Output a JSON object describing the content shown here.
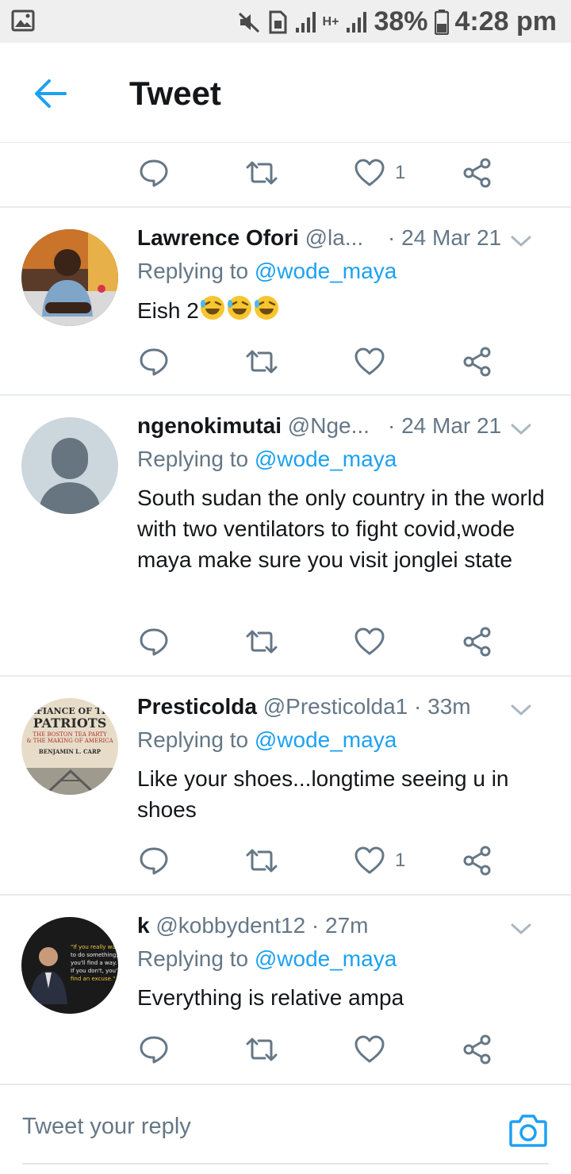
{
  "status_bar": {
    "battery": "38%",
    "time": "4:28 pm",
    "network": "H+"
  },
  "header": {
    "title": "Tweet"
  },
  "top_actions": {
    "like_count": "1"
  },
  "tweets": [
    {
      "name": "Lawrence Ofori",
      "handle": "@la...",
      "time": "· 24 Mar 21",
      "replying_prefix": "Replying to ",
      "replying_to": "@wode_maya",
      "text": "Eish 2",
      "like_count": ""
    },
    {
      "name": "ngenokimutai",
      "handle": "@Nge...",
      "time": "· 24 Mar 21",
      "replying_prefix": "Replying to ",
      "replying_to": "@wode_maya",
      "text": "South sudan the only  country in the world with two ventilators  to fight covid,wode maya make sure you visit jonglei state",
      "like_count": ""
    },
    {
      "name": "Presticolda",
      "handle": "@Presticolda1",
      "time": "· 33m",
      "replying_prefix": "Replying to ",
      "replying_to": "@wode_maya",
      "text": "Like your shoes...longtime seeing u in shoes",
      "like_count": "1",
      "avatar_text": {
        "line1": "EFIANCE OF TH",
        "line2": "PATRIOTS",
        "line3": "THE BOSTON TEA PARTY",
        "line4": "& THE MAKING OF AMERICA",
        "line5": "BENJAMIN L. CARP"
      }
    },
    {
      "name": "k",
      "handle": "@kobbydent12",
      "time": "· 27m",
      "replying_prefix": "Replying to ",
      "replying_to": "@wode_maya",
      "text": "Everything is relative ampa",
      "like_count": "",
      "avatar_text": {
        "line1": "\"If you really want",
        "line2": "to do something,",
        "line3": "you'll find a way.",
        "line4": "If you don't, you'll",
        "line5": "find an excuse.\""
      }
    }
  ],
  "reply_box": {
    "placeholder": "Tweet your reply"
  },
  "colors": {
    "accent": "#1da1f2",
    "secondary_text": "#657786",
    "divider": "#e6ecf0"
  },
  "icons": [
    "back-arrow-icon",
    "reply-icon",
    "retweet-icon",
    "heart-icon",
    "share-icon",
    "chevron-down-icon",
    "camera-icon",
    "laughing-emoji"
  ]
}
